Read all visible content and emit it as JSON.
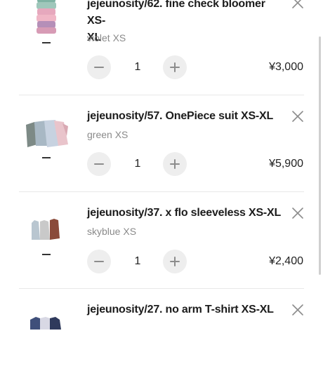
{
  "cart": {
    "items": [
      {
        "name_line1": "jejeunosity/62. fine check bloomer XS-",
        "name_line2": "XL",
        "variant": "violet XS",
        "quantity": "1",
        "price": "¥3,000",
        "image_icon": "product-image-bloomer"
      },
      {
        "name_line1": "jejeunosity/57. OnePiece suit XS-XL",
        "variant": "green XS",
        "quantity": "1",
        "price": "¥5,900",
        "image_icon": "product-image-onepiece"
      },
      {
        "name_line1": "jejeunosity/37. x flo sleeveless XS-XL",
        "variant": "skyblue XS",
        "quantity": "1",
        "price": "¥2,400",
        "image_icon": "product-image-sleeveless"
      },
      {
        "name_line1": "jejeunosity/27. no arm T-shirt XS-XL",
        "image_icon": "product-image-tshirt"
      }
    ]
  },
  "icons": {
    "decrease": "minus-icon",
    "increase": "plus-icon",
    "remove": "close-icon"
  },
  "colors": {
    "button_bg": "#eeeeee",
    "icon": "#8c8c8c",
    "divider": "#e8e8e8",
    "variant_text": "#8a8a8a"
  }
}
